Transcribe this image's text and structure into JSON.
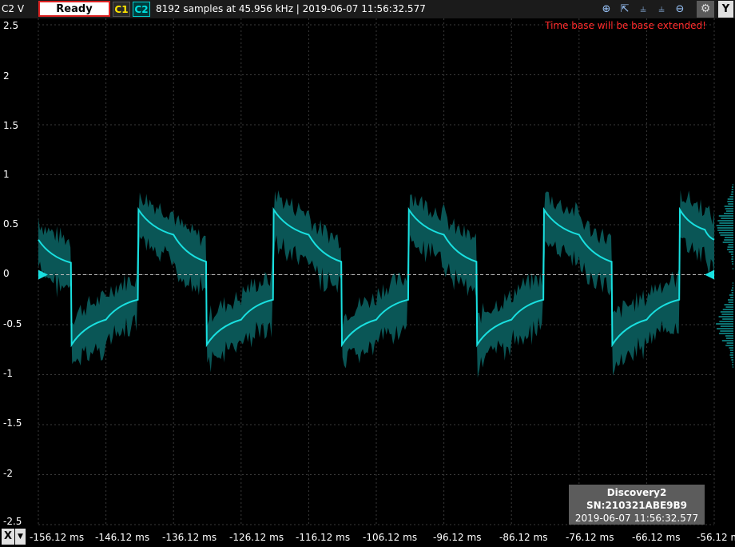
{
  "header": {
    "channel_label": "C2 V",
    "ready_label": "Ready",
    "c1_label": "C1",
    "c2_label": "C2",
    "status": "8192 samples at 45.956 kHz | 2019-06-07 11:56:32.577",
    "y_label": "Y",
    "toolbar_icons": [
      "zoom-in-icon",
      "zoom-fit-icon",
      "ruler-icon",
      "ruler-icon",
      "ruler-icon",
      "zoom-out-icon",
      "settings-icon"
    ]
  },
  "warning": "Time base will be base extended!",
  "y_axis": {
    "labels": [
      "2.5",
      "2",
      "1.5",
      "1",
      "0.5",
      "0",
      "-0.5",
      "-1",
      "-1.5",
      "-2",
      "-2.5"
    ]
  },
  "x_axis": {
    "button": "X",
    "labels": [
      "-156.12 ms",
      "-146.12 ms",
      "-136.12 ms",
      "-126.12 ms",
      "-116.12 ms",
      "-106.12 ms",
      "-96.12 ms",
      "-86.12 ms",
      "-76.12 ms",
      "-66.12 ms",
      "-56.12 ms"
    ]
  },
  "device": {
    "name": "Discovery2",
    "serial": "SN:210321ABE9B9",
    "timestamp": "2019-06-07 11:56:32.577"
  },
  "colors": {
    "trace": "#19e0e0",
    "envelope": "#0a5656",
    "grid": "#3a3a3a",
    "warning": "#ff2a2a"
  },
  "chart_data": {
    "type": "line",
    "title": "",
    "xlabel": "",
    "ylabel": "C2 V",
    "xlim": [
      -156.12,
      -56.12
    ],
    "ylim": [
      -2.5,
      2.5
    ],
    "grid": true,
    "series": [
      {
        "x": [
          -156.12,
          -151.3,
          -151.2,
          -146.12,
          -141.4,
          -141.3,
          -136.12,
          -131.3,
          -131.2,
          -126.12,
          -121.4,
          -121.3,
          -116.12,
          -111.3,
          -111.2,
          -106.12,
          -101.4,
          -101.3,
          -96.12,
          -91.3,
          -91.2,
          -86.12,
          -81.4,
          -81.3,
          -76.12,
          -71.3,
          -71.2,
          -66.12,
          -61.3,
          -61.2,
          -57.5,
          -56.12
        ],
        "values": [
          0.35,
          0.12,
          -0.7,
          -0.45,
          -0.25,
          0.65,
          0.4,
          0.13,
          -0.7,
          -0.45,
          -0.25,
          0.65,
          0.4,
          0.13,
          -0.7,
          -0.45,
          -0.25,
          0.65,
          0.4,
          0.13,
          -0.7,
          -0.45,
          -0.25,
          0.65,
          0.4,
          0.13,
          -0.7,
          -0.45,
          -0.25,
          0.65,
          0.45,
          0.35
        ]
      }
    ]
  }
}
